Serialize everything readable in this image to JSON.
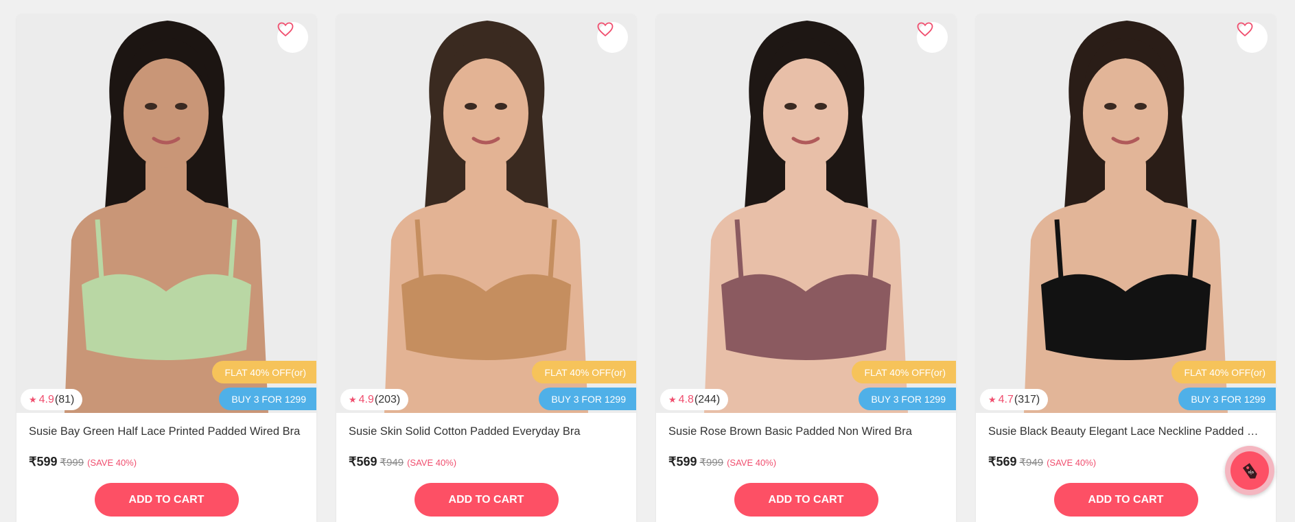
{
  "colors": {
    "accent": "#fd5065",
    "rating": "#f04e6e",
    "flat_badge": "#f6c35a",
    "buy3_badge": "#4fb0e8"
  },
  "icons": {
    "wishlist": "heart-icon",
    "rating": "star-icon",
    "floating": "offer-tag-icon"
  },
  "products": [
    {
      "title": "Susie Bay Green Half Lace Printed Padded Wired Bra",
      "rating": "4.9",
      "reviews": "(81)",
      "price": "₹599",
      "mrp": "₹999",
      "save": "(SAVE 40%)",
      "offer_flat": "FLAT 40% OFF(or)",
      "offer_buy3": "BUY 3 FOR 1299",
      "cart_label": "ADD TO CART",
      "garment_color": "#b9d7a4",
      "skin_color": "#c99677",
      "hair_color": "#1c1512"
    },
    {
      "title": "Susie Skin Solid Cotton Padded Everyday Bra",
      "rating": "4.9",
      "reviews": "(203)",
      "price": "₹569",
      "mrp": "₹949",
      "save": "(SAVE 40%)",
      "offer_flat": "FLAT 40% OFF(or)",
      "offer_buy3": "BUY 3 FOR 1299",
      "cart_label": "ADD TO CART",
      "garment_color": "#c58e5f",
      "skin_color": "#e3b394",
      "hair_color": "#3a2a20"
    },
    {
      "title": "Susie Rose Brown Basic Padded Non Wired Bra",
      "rating": "4.8",
      "reviews": "(244)",
      "price": "₹599",
      "mrp": "₹999",
      "save": "(SAVE 40%)",
      "offer_flat": "FLAT 40% OFF(or)",
      "offer_buy3": "BUY 3 FOR 1299",
      "cart_label": "ADD TO CART",
      "garment_color": "#8b5a60",
      "skin_color": "#e8bfa8",
      "hair_color": "#1e1714"
    },
    {
      "title": "Susie Black Beauty Elegant Lace Neckline Padded Non Wired Bra",
      "rating": "4.7",
      "reviews": "(317)",
      "price": "₹569",
      "mrp": "₹949",
      "save": "(SAVE 40%)",
      "offer_flat": "FLAT 40% OFF(or)",
      "offer_buy3": "BUY 3 FOR 1299",
      "cart_label": "ADD TO CART",
      "garment_color": "#121212",
      "skin_color": "#e2b598",
      "hair_color": "#2a1d17"
    }
  ]
}
